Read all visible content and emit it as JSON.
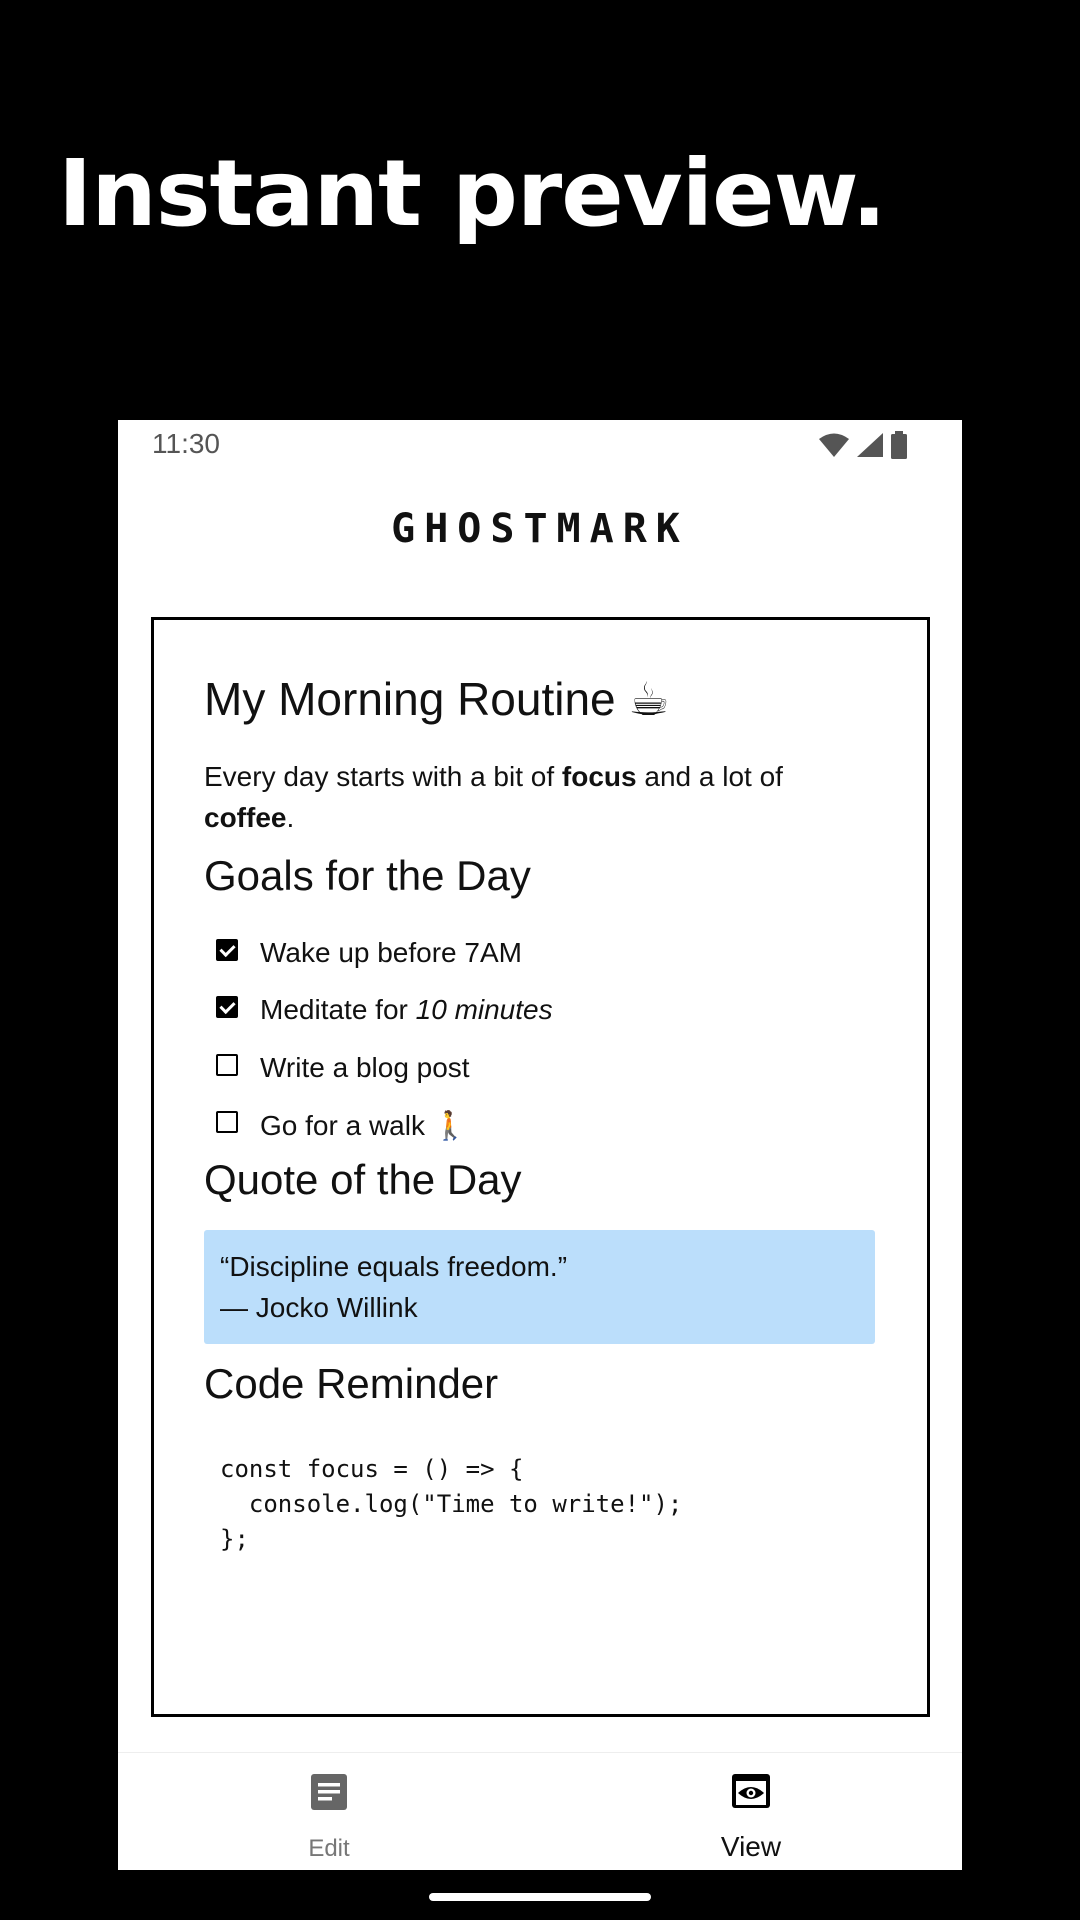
{
  "headline": "Instant preview.",
  "status_bar": {
    "time": "11:30",
    "icons": [
      "wifi-icon",
      "cellular-signal-icon",
      "battery-icon"
    ]
  },
  "app": {
    "title": "GHOSTMARK"
  },
  "preview": {
    "heading1": "My Morning Routine ☕",
    "paragraph": {
      "text1": "Every day starts with a bit of ",
      "bold1": "focus",
      "text2": " and a lot of ",
      "bold2": "coffee",
      "text3": "."
    },
    "goals_heading": "Goals for the Day",
    "tasks": [
      {
        "checked": true,
        "text": "Wake up before 7AM",
        "emphasis": ""
      },
      {
        "checked": true,
        "text": "Meditate for ",
        "emphasis": "10 minutes"
      },
      {
        "checked": false,
        "text": "Write a blog post",
        "emphasis": ""
      },
      {
        "checked": false,
        "text": "Go for a walk 🚶",
        "emphasis": ""
      }
    ],
    "quote_heading": "Quote of the Day",
    "quote": {
      "line1": "“Discipline equals freedom.”",
      "line2": "— Jocko Willink",
      "background": "#bbdefb"
    },
    "code_heading": "Code Reminder",
    "code_lines": [
      "const focus = () => {",
      "  console.log(\"Time to write!\");",
      "};"
    ]
  },
  "bottom_nav": {
    "items": [
      {
        "label": "Edit",
        "icon": "document-icon",
        "active": false
      },
      {
        "label": "View",
        "icon": "eye-icon",
        "active": true
      }
    ]
  }
}
